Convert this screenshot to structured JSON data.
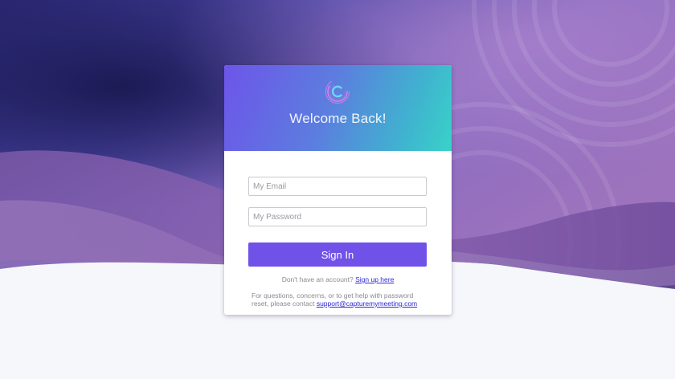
{
  "header": {
    "welcome": "Welcome Back!"
  },
  "form": {
    "email_placeholder": "My Email",
    "email_value": "",
    "password_placeholder": "My Password",
    "password_value": "",
    "signin_label": "Sign In"
  },
  "signup": {
    "prompt": "Don't have an account?",
    "link": "Sign up here"
  },
  "help": {
    "text": "For questions, concerns, or to get help with password reset, please contact",
    "email": "support@capturemymeeting.com"
  },
  "icons": {
    "logo": "capture-logo-icon"
  },
  "colors": {
    "accent": "#7152e8",
    "header_start": "#6d55e9",
    "header_end": "#39d2c8",
    "link": "#2b28d8",
    "background_light": "#f6f7fb"
  }
}
